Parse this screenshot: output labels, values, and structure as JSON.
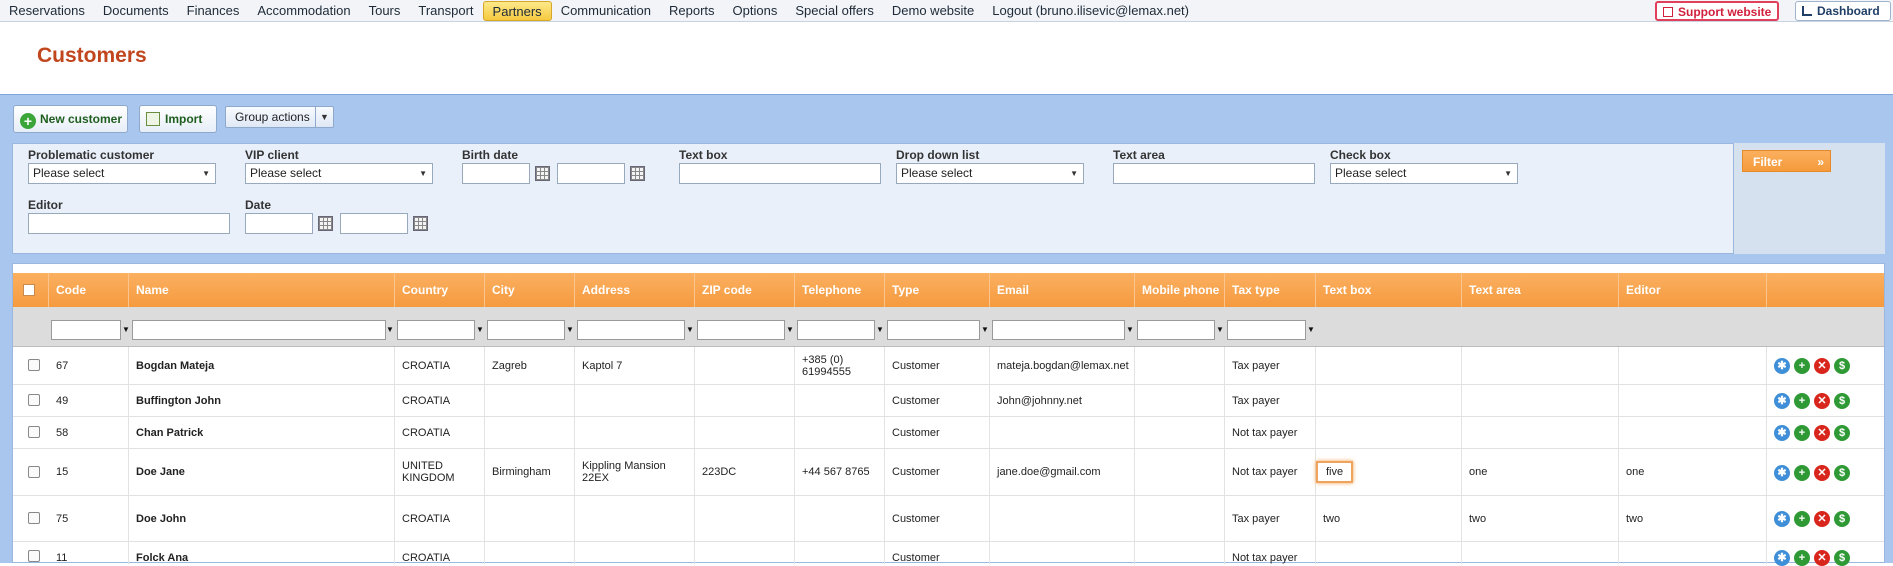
{
  "menu": {
    "items": [
      "Reservations",
      "Documents",
      "Finances",
      "Accommodation",
      "Tours",
      "Transport",
      "Partners",
      "Communication",
      "Reports",
      "Options",
      "Special offers",
      "Demo website",
      "Logout (bruno.ilisevic@lemax.net)"
    ],
    "active": "Partners",
    "support_label": "Support website",
    "dashboard_label": "Dashboard"
  },
  "page": {
    "title": "Customers"
  },
  "toolbar": {
    "new_customer": "New customer",
    "import": "Import",
    "group_actions": "Group actions"
  },
  "filters": {
    "problematic_label": "Problematic customer",
    "problematic_value": "Please select",
    "vip_label": "VIP client",
    "vip_value": "Please select",
    "birth_label": "Birth date",
    "textbox_label": "Text box",
    "dropdown_label": "Drop down list",
    "dropdown_value": "Please select",
    "textarea_label": "Text area",
    "checkbox_label": "Check box",
    "checkbox_value": "Please select",
    "editor_label": "Editor",
    "date_label": "Date",
    "filter_button": "Filter"
  },
  "grid": {
    "columns": [
      "Code",
      "Name",
      "Country",
      "City",
      "Address",
      "ZIP code",
      "Telephone",
      "Type",
      "Email",
      "Mobile phone",
      "Tax type",
      "Text box",
      "Text area",
      "Editor"
    ],
    "rows": [
      {
        "code": "67",
        "name": "Bogdan Mateja",
        "country": "CROATIA",
        "city": "Zagreb",
        "address": "Kaptol 7",
        "zip": "",
        "phone": "+385 (0) 61994555",
        "type": "Customer",
        "email": "mateja.bogdan@lemax.net",
        "mobile": "",
        "tax": "Tax payer",
        "textbox": "",
        "textarea": "",
        "editor": ""
      },
      {
        "code": "49",
        "name": "Buffington John",
        "country": "CROATIA",
        "city": "",
        "address": "",
        "zip": "",
        "phone": "",
        "type": "Customer",
        "email": "John@johnny.net",
        "mobile": "",
        "tax": "Tax payer",
        "textbox": "",
        "textarea": "",
        "editor": ""
      },
      {
        "code": "58",
        "name": "Chan Patrick",
        "country": "CROATIA",
        "city": "",
        "address": "",
        "zip": "",
        "phone": "",
        "type": "Customer",
        "email": "",
        "mobile": "",
        "tax": "Not tax payer",
        "textbox": "",
        "textarea": "",
        "editor": ""
      },
      {
        "code": "15",
        "name": "Doe Jane",
        "country": "UNITED KINGDOM",
        "city": "Birmingham",
        "address": "Kippling Mansion 22EX",
        "zip": "223DC",
        "phone": "+44 567 8765",
        "type": "Customer",
        "email": "jane.doe@gmail.com",
        "mobile": "",
        "tax": "Not tax payer",
        "textbox": "five",
        "textarea": "one",
        "editor": "one"
      },
      {
        "code": "75",
        "name": "Doe John",
        "country": "CROATIA",
        "city": "",
        "address": "",
        "zip": "",
        "phone": "",
        "type": "Customer",
        "email": "",
        "mobile": "",
        "tax": "Tax payer",
        "textbox": "two",
        "textarea": "two",
        "editor": "two"
      },
      {
        "code": "11",
        "name": "Folck Ana",
        "country": "CROATIA",
        "city": "",
        "address": "",
        "zip": "",
        "phone": "",
        "type": "Customer",
        "email": "",
        "mobile": "",
        "tax": "Not tax payer",
        "textbox": "",
        "textarea": "",
        "editor": ""
      }
    ]
  }
}
